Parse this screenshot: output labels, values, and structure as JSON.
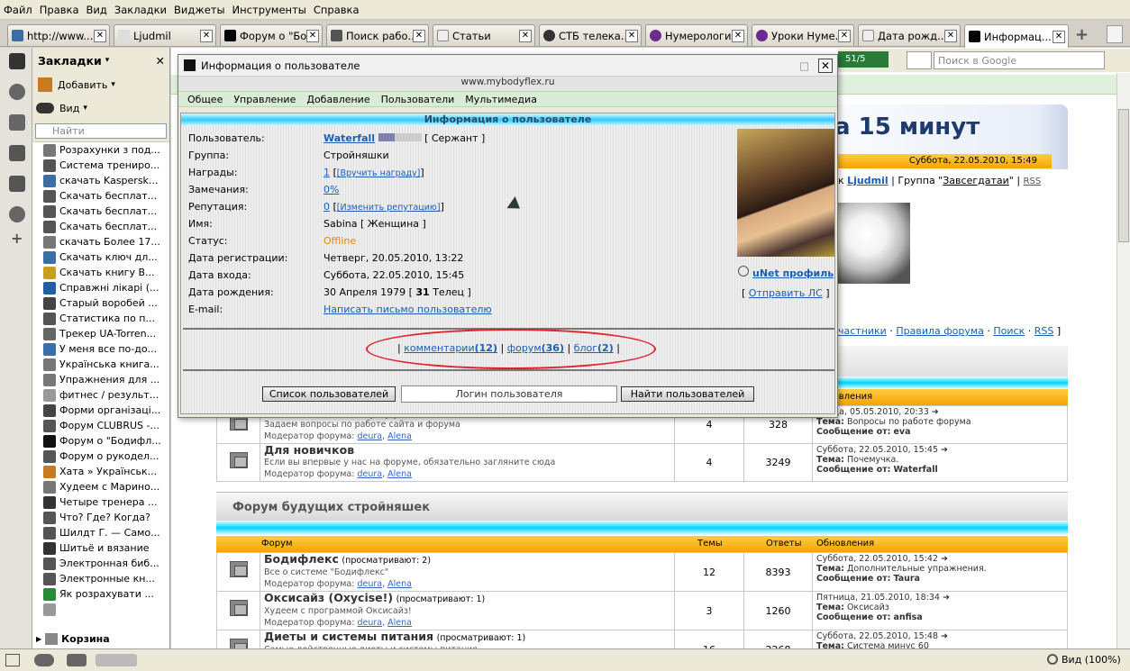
{
  "menubar": [
    "Файл",
    "Правка",
    "Вид",
    "Закладки",
    "Виджеты",
    "Инструменты",
    "Справка"
  ],
  "tabs": [
    {
      "label": "http://www....",
      "color": "#3a6ea5"
    },
    {
      "label": "Ljudmil",
      "color": "#ffffff"
    },
    {
      "label": "Форум о \"Бо...",
      "color": "#000000"
    },
    {
      "label": "Поиск рабо...",
      "color": "#555555"
    },
    {
      "label": "Статьи",
      "color": "#ffffff"
    },
    {
      "label": "СТБ телека...",
      "color": "#333333"
    },
    {
      "label": "Нумерология",
      "color": "#6a2c91"
    },
    {
      "label": "Уроки Нуме...",
      "color": "#6a2c91"
    },
    {
      "label": "Дата рожд...",
      "color": "#ffffff"
    },
    {
      "label": "Информац...",
      "color": "#000000"
    }
  ],
  "sidebar": {
    "title": "Закладки",
    "add_label": "Добавить",
    "view_label": "Вид",
    "search_placeholder": "Найти",
    "items": [
      "Розрахунки з под...",
      "Система трениро...",
      "скачать Kaspersk...",
      "Скачать бесплат...",
      "Скачать бесплат...",
      "Скачать бесплат...",
      "скачать Более 17...",
      "Скачать ключ дл...",
      "Скачать книгу В...",
      "Справжні лікарі (...",
      "Старый воробей ...",
      "Статистика по п...",
      "Трекер UA-Torren...",
      "У меня все по-до...",
      "Українська книга...",
      "Упражнения для ...",
      "фитнес / результ...",
      "Форми організаці...",
      "Форум CLUBRUS -...",
      "Форум о \"Бодифл...",
      "Форум о рукодел...",
      "Хата » Українськ...",
      "Худеем с Марино...",
      "Четыре тренера ...",
      "Что? Где? Когда?",
      "Шилдт Г. — Само...",
      "Шитьё и вязание",
      "Электронная биб...",
      "Электронные кн...",
      "Як розрахувати ...",
      ""
    ],
    "folder": "Корзина"
  },
  "search_google": "Поиск в Google",
  "speed": "51/5",
  "page": {
    "title_tail": "а 15 минут",
    "date": "Суббота, 22.05.2010, 15:49",
    "user_line_prefix": "к",
    "user": "Ljudmil",
    "group_prefix": "| Группа \"",
    "group": "Завсегдатаи",
    "group_suffix": "\" |",
    "rss": "RSS",
    "nav": [
      "частники",
      "Правила форума",
      "Поиск",
      "RSS"
    ],
    "upd_header": "Обновления",
    "section2": "Форум будущих стройняшек",
    "col_forum": "Форум",
    "col_topics": "Темы",
    "col_replies": "Ответы",
    "col_updates": "Обновления",
    "mod_label": "Модератор форума:",
    "forums_top": [
      {
        "name": "Работа сайта и форума",
        "desc": "Задаем вопросы по работе сайта и форума",
        "topics": "4",
        "replies": "328",
        "date": "Среда, 05.05.2010, 20:33",
        "theme": "Вопросы по работе форума",
        "from": "eva"
      },
      {
        "name": "Для новичков",
        "desc": "Если вы впервые у нас на форуме, обязательно загляните сюда",
        "topics": "4",
        "replies": "3249",
        "date": "Суббота, 22.05.2010, 15:45",
        "theme": "Почемучка.",
        "from": "Waterfall"
      }
    ],
    "forums": [
      {
        "name": "Бодифлекс",
        "views": "(просматривают: 2)",
        "desc": "Все о системе \"Бодифлекс\"",
        "topics": "12",
        "replies": "8393",
        "date": "Суббота, 22.05.2010, 15:42",
        "theme": "Дополнительные упражнения.",
        "from": "Taura"
      },
      {
        "name": "Оксисайз (Oxycise!)",
        "views": "(просматривают: 1)",
        "desc": "Худеем с программой Оксисайз!",
        "topics": "3",
        "replies": "1260",
        "date": "Пятница, 21.05.2010, 18:34",
        "theme": "Оксисайз",
        "from": "anfisa"
      },
      {
        "name": "Диеты и системы питания",
        "views": "(просматривают: 1)",
        "desc": "Самые действенные диеты и системы питания",
        "topics": "16",
        "replies": "2268",
        "date": "Суббота, 22.05.2010, 15:48",
        "theme": "Система минус 60",
        "from": ""
      }
    ],
    "mods": [
      "deura",
      "Alena"
    ],
    "theme_label": "Тема:",
    "from_label": "Сообщение от:"
  },
  "dialog": {
    "title": "Информация о пользователе",
    "url": "www.mybodyflex.ru",
    "menu": [
      "Общее",
      "Управление",
      "Добавление",
      "Пользователи",
      "Мультимедиа"
    ],
    "heading": "Информация о пользователе",
    "fields": [
      {
        "label": "Пользователь:",
        "value": "Waterfall",
        "extra": "[ Сержант ]"
      },
      {
        "label": "Группа:",
        "value": "Стройняшки"
      },
      {
        "label": "Награды:",
        "value": "1",
        "extra": "[Вручить награду]"
      },
      {
        "label": "Замечания:",
        "value": "0%"
      },
      {
        "label": "Репутация:",
        "value": "0",
        "extra": "[Изменить репутацию]"
      },
      {
        "label": "Имя:",
        "value": "Sabina [ Женщина ]"
      },
      {
        "label": "Статус:",
        "value": "Offline"
      },
      {
        "label": "Дата регистрации:",
        "value": "Четверг, 20.05.2010, 13:22"
      },
      {
        "label": "Дата входа:",
        "value": "Суббота, 22.05.2010, 15:45"
      },
      {
        "label": "Дата рождения:",
        "value_pre": "30 Апреля 1979 [",
        "value_bold": "31",
        "value_post": "Телец ]"
      },
      {
        "label": "E-mail:",
        "value": "Написать письмо пользователю"
      }
    ],
    "unet": "uNet профиль",
    "send_pm": "Отправить ЛС",
    "links": [
      {
        "text": "комментарии",
        "n": "(12)"
      },
      {
        "text": "форум",
        "n": "(36)"
      },
      {
        "text": "блог",
        "n": "(2)"
      }
    ],
    "btn_list": "Список пользователей",
    "login_placeholder": "Логин пользователя",
    "btn_find": "Найти пользователей",
    "status_color": "#e68a00",
    "annot_color": "#e0202a"
  },
  "status": {
    "zoom": "Вид (100%)"
  }
}
